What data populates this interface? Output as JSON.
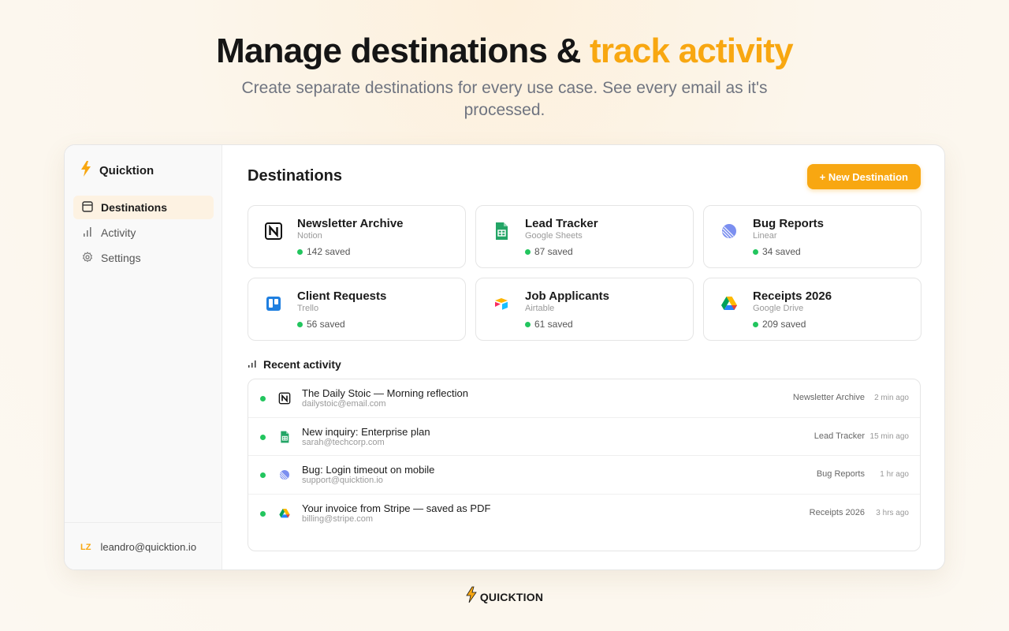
{
  "hero": {
    "title_main": "Manage destinations & ",
    "title_accent": "track activity",
    "subtitle": "Create separate destinations for every use case. See every email as it's processed."
  },
  "brand": {
    "name": "Quicktion",
    "icon": "lightning-bolt-icon",
    "accent": "#f8a711"
  },
  "sidebar": {
    "items": [
      {
        "label": "Destinations",
        "icon": "window-icon",
        "active": true
      },
      {
        "label": "Activity",
        "icon": "bar-chart-icon",
        "active": false
      },
      {
        "label": "Settings",
        "icon": "gear-icon",
        "active": false
      }
    ],
    "user": {
      "initials": "LZ",
      "email": "leandro@quicktion.io"
    }
  },
  "main": {
    "title": "Destinations",
    "new_button": "+ New Destination",
    "destinations": [
      {
        "name": "Newsletter Archive",
        "service": "Notion",
        "count": "142 saved",
        "icon": "notion-icon"
      },
      {
        "name": "Lead Tracker",
        "service": "Google Sheets",
        "count": "87 saved",
        "icon": "google-sheets-icon"
      },
      {
        "name": "Bug Reports",
        "service": "Linear",
        "count": "34 saved",
        "icon": "linear-icon"
      },
      {
        "name": "Client Requests",
        "service": "Trello",
        "count": "56 saved",
        "icon": "trello-icon"
      },
      {
        "name": "Job Applicants",
        "service": "Airtable",
        "count": "61 saved",
        "icon": "airtable-icon"
      },
      {
        "name": "Receipts 2026",
        "service": "Google Drive",
        "count": "209 saved",
        "icon": "google-drive-icon"
      }
    ],
    "activity_title": "Recent activity",
    "activity": [
      {
        "title": "The Daily Stoic — Morning reflection",
        "email": "dailystoic@email.com",
        "destination": "Newsletter Archive",
        "time": "2 min ago",
        "icon": "notion-icon"
      },
      {
        "title": "New inquiry: Enterprise plan",
        "email": "sarah@techcorp.com",
        "destination": "Lead Tracker",
        "time": "15 min ago",
        "icon": "google-sheets-icon"
      },
      {
        "title": "Bug: Login timeout on mobile",
        "email": "support@quicktion.io",
        "destination": "Bug Reports",
        "time": "1 hr ago",
        "icon": "linear-icon"
      },
      {
        "title": "Your invoice from Stripe — saved as PDF",
        "email": "billing@stripe.com",
        "destination": "Receipts 2026",
        "time": "3 hrs ago",
        "icon": "google-drive-icon"
      }
    ]
  },
  "footer": {
    "brand": "QUICKTION"
  },
  "colors": {
    "accent": "#f8a711",
    "status_green": "#22c55e"
  }
}
